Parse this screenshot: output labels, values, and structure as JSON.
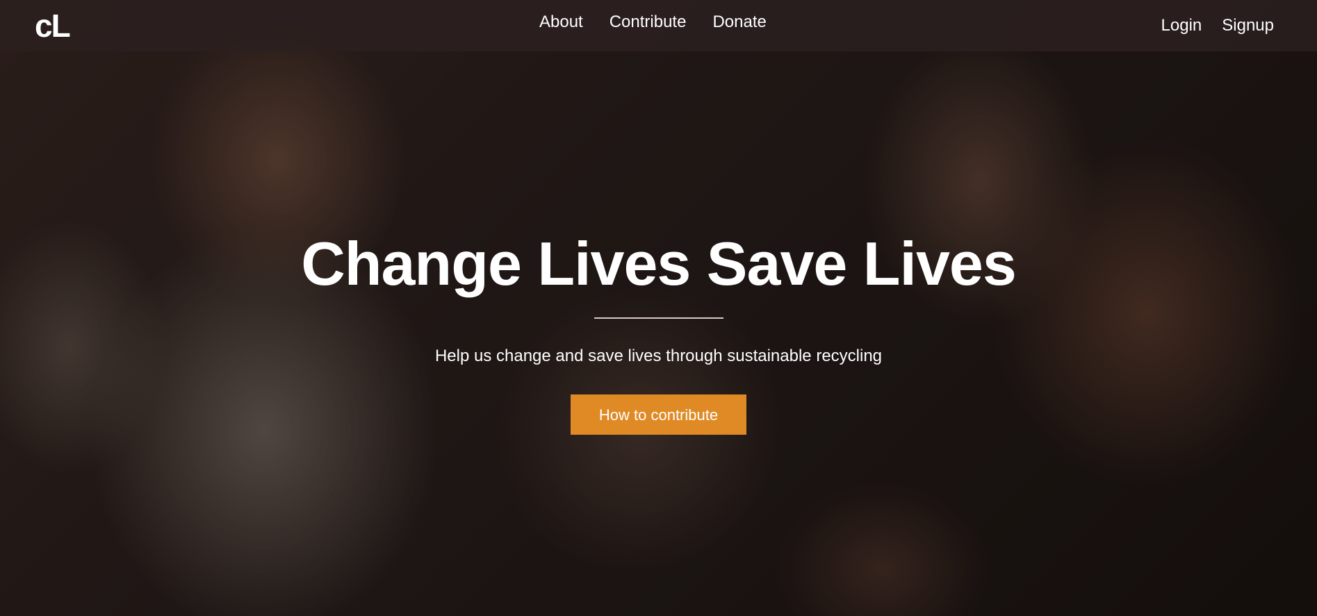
{
  "nav": {
    "logo": "cL",
    "center_links": [
      "About",
      "Contribute",
      "Donate"
    ],
    "login": "Login",
    "signup": "Signup"
  },
  "hero": {
    "headline": "Change Lives Save Lives",
    "subtitle": "Help us change and save lives through sustainable recycling",
    "cta_label": "How to contribute"
  },
  "colors": {
    "navbar_bg": "#2c2020",
    "cta_bg": "#e08a25",
    "text": "#ffffff"
  }
}
